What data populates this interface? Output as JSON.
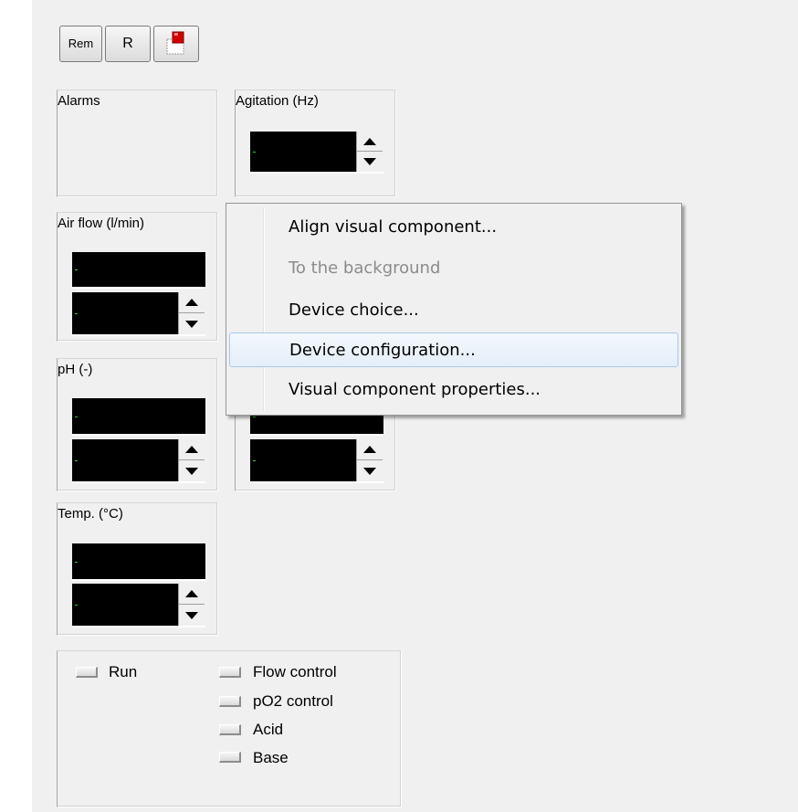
{
  "toolbar": {
    "rem_label": "Rem",
    "r_label": "R",
    "icon": "display-settings-icon"
  },
  "panels": {
    "alarms": {
      "title": "Alarms"
    },
    "agitation": {
      "title": "Agitation (Hz)",
      "value": "-"
    },
    "airflow": {
      "title": "Air flow (l/min)",
      "display": "-",
      "setpoint": "-"
    },
    "ph": {
      "title": "pH (-)",
      "display": "-",
      "setpoint": "-"
    },
    "po2": {
      "display": "-",
      "setpoint": "-"
    },
    "temp": {
      "title": "Temp. (°C)",
      "display": "-",
      "setpoint": "-"
    }
  },
  "status": {
    "run": "Run",
    "flow_control": "Flow control",
    "po2_control": "pO2 control",
    "acid": "Acid",
    "base": "Base"
  },
  "context_menu": {
    "items": [
      {
        "label": "Align visual component...",
        "enabled": true,
        "highlighted": false
      },
      {
        "label": "To the background",
        "enabled": false,
        "highlighted": false
      },
      {
        "label": "Device choice...",
        "enabled": true,
        "highlighted": false
      },
      {
        "label": "Device configuration...",
        "enabled": true,
        "highlighted": true
      },
      {
        "label": "Visual component properties...",
        "enabled": true,
        "highlighted": false
      }
    ]
  },
  "colors": {
    "background": "#f0f0f0",
    "display_bg": "#000000",
    "display_text": "#39c73f",
    "menu_highlight_border": "#a8c8ec",
    "disabled_text": "#8b8b8b"
  }
}
